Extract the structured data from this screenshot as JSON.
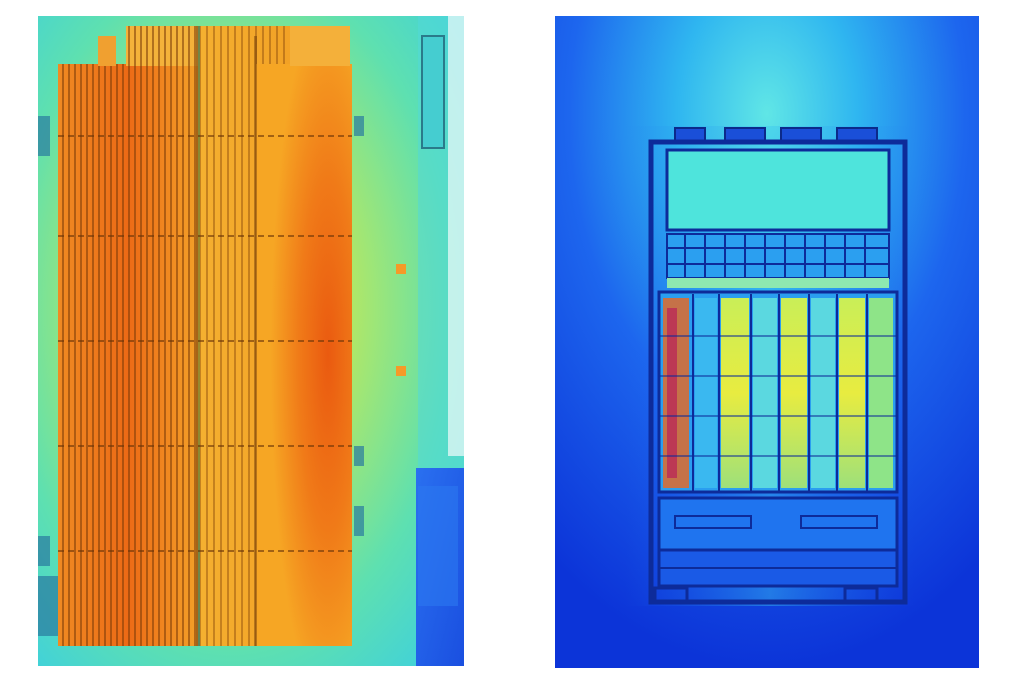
{
  "figure": {
    "panels": [
      {
        "id": "left",
        "subject": "heatsink-fin-array-thermal-map",
        "palette": [
          "#1f4fe0",
          "#32b8ec",
          "#45e3c8",
          "#8ee66a",
          "#f0ea3c",
          "#f7a81e",
          "#f08214",
          "#ea5a0c"
        ]
      },
      {
        "id": "right",
        "subject": "server-chassis-thermal-map",
        "palette": [
          "#0a2fd6",
          "#1650ee",
          "#1f78f2",
          "#2aa8f0",
          "#40d0ee",
          "#7ee9d2",
          "#d8ee48",
          "#f07818",
          "#c8205a"
        ]
      }
    ]
  }
}
